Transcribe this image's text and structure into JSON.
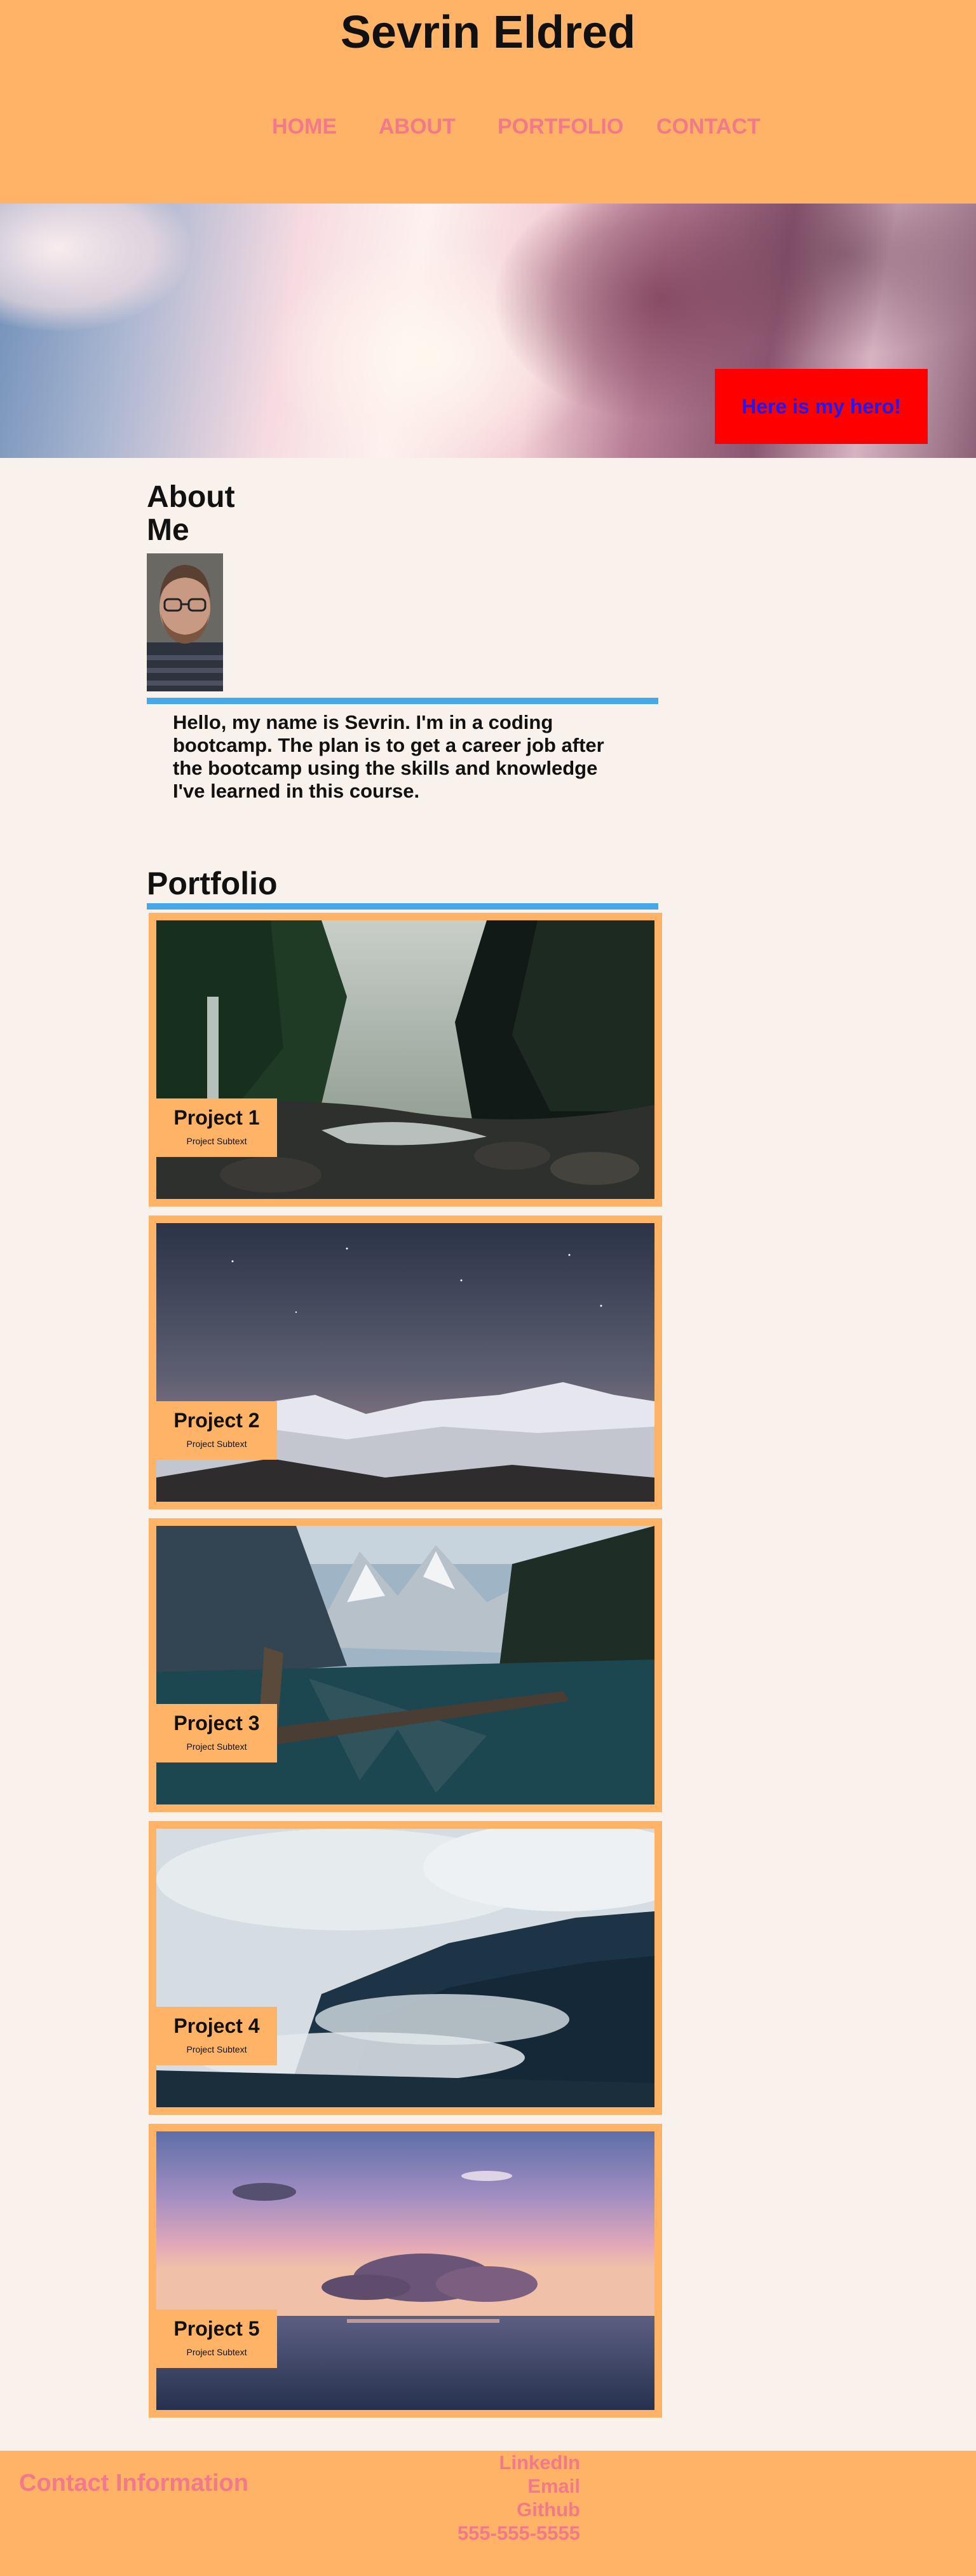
{
  "header": {
    "title": "Sevrin Eldred",
    "nav": [
      {
        "label": "HOME"
      },
      {
        "label": "ABOUT"
      },
      {
        "label": "PORTFOLIO"
      },
      {
        "label": "CONTACT"
      }
    ]
  },
  "hero": {
    "box_text": "Here is my hero!",
    "box_color": "#ff0000",
    "box_text_color": "#1a1aff"
  },
  "about": {
    "title": "About Me",
    "text": "Hello, my name is Sevrin. I'm in a coding bootcamp. The plan is to get a career job after the bootcamp using the skills and knowledge I've learned in this course."
  },
  "portfolio": {
    "title": "Portfolio",
    "projects": [
      {
        "title": "Project 1",
        "subtitle": "Project Subtext",
        "scene": "forest-river"
      },
      {
        "title": "Project 2",
        "subtitle": "Project Subtext",
        "scene": "snowy-mountains-night"
      },
      {
        "title": "Project 3",
        "subtitle": "Project Subtext",
        "scene": "mountain-lake"
      },
      {
        "title": "Project 4",
        "subtitle": "Project Subtext",
        "scene": "misty-forest"
      },
      {
        "title": "Project 5",
        "subtitle": "Project Subtext",
        "scene": "ocean-sunset"
      }
    ]
  },
  "footer": {
    "title": "Contact Information",
    "links": [
      {
        "label": "LinkedIn"
      },
      {
        "label": "Email"
      },
      {
        "label": "Github"
      },
      {
        "label": "555-555-5555"
      }
    ]
  },
  "colors": {
    "accent": "#ffb366",
    "link": "#f07a8a",
    "divider": "#45a8e8",
    "background": "#f9f1ec"
  }
}
